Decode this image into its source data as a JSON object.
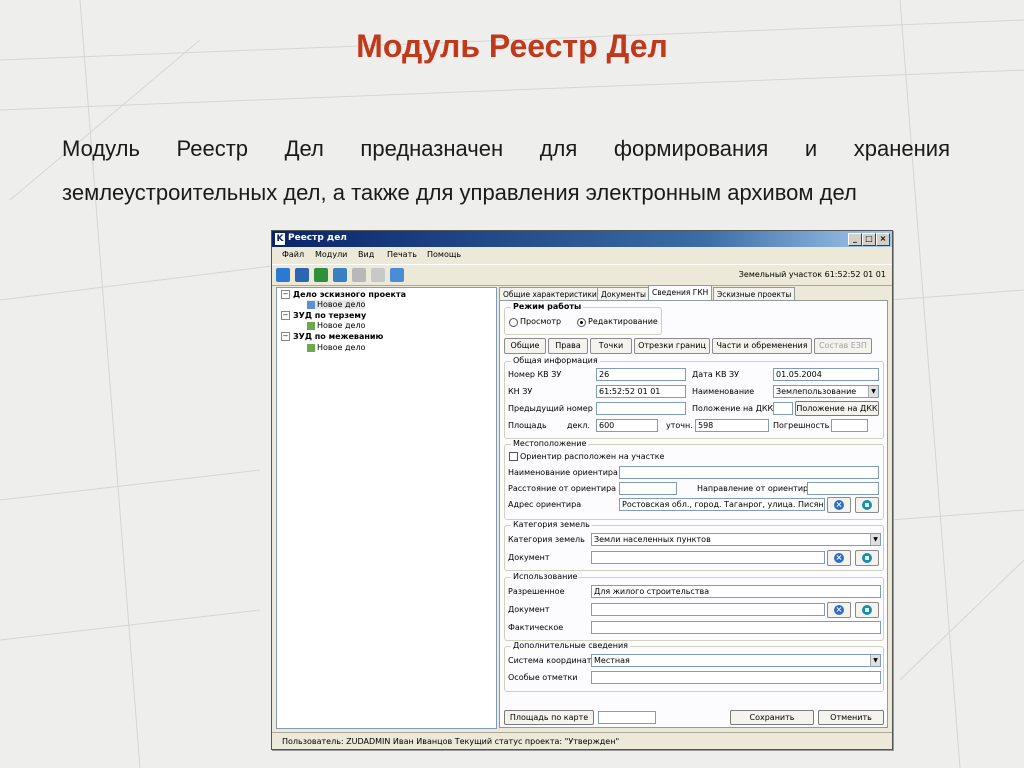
{
  "slide": {
    "title": "Модуль Реестр Дел",
    "body": "Модуль Реестр Дел предназначен для формирования и хранения землеустроительных дел, а также для управления электронным архивом дел"
  },
  "window": {
    "title": "Реестр дел",
    "menu": [
      "Файл",
      "Модули",
      "Вид",
      "Печать",
      "Помощь"
    ],
    "parcel": "Земельный участок 61:52:52 01 01",
    "status": "Пользователь: ZUDADMIN  Иван Иванцов  Текущий статус проекта: \"Утвержден\""
  },
  "tree": [
    {
      "label": "Дело эскизного проекта",
      "child": "Новое дело"
    },
    {
      "label": "ЗУД по терзему",
      "child": "Новое дело"
    },
    {
      "label": "ЗУД по межеванию",
      "child": "Новое дело"
    }
  ],
  "tabs": [
    "Общие характеристики",
    "Документы",
    "Сведения ГКН",
    "Эскизные проекты"
  ],
  "mode": {
    "title": "Режим работы",
    "view": "Просмотр",
    "edit": "Редактирование"
  },
  "subtabs": [
    "Общие",
    "Права",
    "Точки",
    "Отрезки границ",
    "Части и обременения",
    "Состав ЕЗП"
  ],
  "general": {
    "title": "Общая информация",
    "kv_number_label": "Номер КВ ЗУ",
    "kv_number": "26",
    "kv_date_label": "Дата КВ ЗУ",
    "kv_date": "01.05.2004",
    "kn_label": "КН ЗУ",
    "kn": "61:52:52 01 01",
    "name_label": "Наименование",
    "name": "Землепользование",
    "prev_label": "Предыдущий номер",
    "prev": "",
    "dkk_label": "Положение на ДКК",
    "dkk": "",
    "dkk_btn": "Положение на ДКК",
    "area_label": "Площадь",
    "decl_label": "декл.",
    "decl": "600",
    "utoch_label": "уточн.",
    "utoch": "598",
    "err_label": "Погрешность",
    "err": ""
  },
  "location": {
    "title": "Местоположение",
    "check_label": "Ориентир расположен на участке",
    "name_label": "Наименование ориентира",
    "name": "",
    "dist_label": "Расстояние от ориентира",
    "dist": "",
    "dir_label": "Направление от ориентира",
    "dir": "",
    "addr_label": "Адрес ориентира",
    "addr": "Ростовская обл., город. Таганрог, улица. Писянско"
  },
  "category": {
    "title": "Категория земель",
    "cat_label": "Категория земель",
    "cat": "Земли населенных пунктов",
    "doc_label": "Документ",
    "doc": ""
  },
  "usage": {
    "title": "Использование",
    "allowed_label": "Разрешенное",
    "allowed": "Для жилого строительства",
    "doc_label": "Документ",
    "doc": "",
    "actual_label": "Фактическое",
    "actual": ""
  },
  "extra": {
    "title": "Дополнительные сведения",
    "coords_label": "Система координат",
    "coords": "Местная",
    "notes_label": "Особые отметки",
    "notes": ""
  },
  "footer": {
    "area_btn": "Площадь по карте",
    "area": "",
    "save": "Сохранить",
    "cancel": "Отменить"
  }
}
